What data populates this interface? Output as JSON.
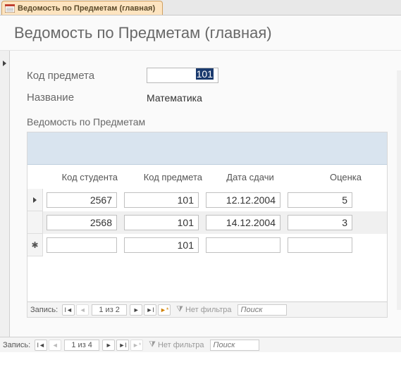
{
  "tab": {
    "title": "Ведомость по Предметам (главная)"
  },
  "header": {
    "title": "Ведомость по Предметам (главная)"
  },
  "fields": {
    "code_label": "Код предмета",
    "code_value": "101",
    "name_label": "Название",
    "name_value": "Математика"
  },
  "subform": {
    "label": "Ведомость по Предметам",
    "columns": {
      "student": "Код студента",
      "subject": "Код предмета",
      "date": "Дата сдачи",
      "grade": "Оценка"
    },
    "rows": [
      {
        "student": "2567",
        "subject": "101",
        "date": "12.12.2004",
        "grade": "5"
      },
      {
        "student": "2568",
        "subject": "101",
        "date": "14.12.2004",
        "grade": "3"
      }
    ],
    "new_row": {
      "student": "",
      "subject": "101",
      "date": "",
      "grade": ""
    }
  },
  "nav_inner": {
    "label": "Запись:",
    "counter": "1 из 2",
    "filter": "Нет фильтра",
    "search_placeholder": "Поиск"
  },
  "nav_outer": {
    "label": "Запись:",
    "counter": "1 из 4",
    "filter": "Нет фильтра",
    "search_placeholder": "Поиск"
  }
}
